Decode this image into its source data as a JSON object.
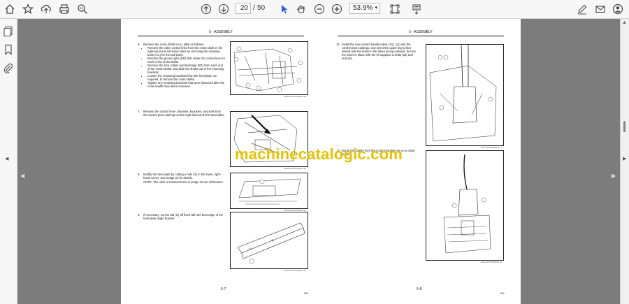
{
  "toolbar": {
    "page_current": "20",
    "page_sep": "/",
    "page_total": "50",
    "zoom": "53.9%"
  },
  "left_page": {
    "header": "5 - ASSEMBLY",
    "steps": [
      {
        "num": "6.",
        "intro": "Remove the cross shafts (AA), (BB) as follows:",
        "bullets": [
          "Remove the valve control links from the cross shaft on the right-hand and left-hand sides by removing the retaining bolts (CC) for the ball joints.",
          "Remove the groove pins (DD) that retain the control lever to each of the cross shafts.",
          "Remove the lock collars and bushings (EE) from each end of the cross shafts, and slide the shafts out of the mounting brackets.",
          "Loosen the mounting brackets from the heel plate, as required, to remove the cross shafts.",
          "Tighten any mounting brackets that were loosened after the cross shafts have been removed."
        ]
      },
      {
        "num": "7.",
        "intro": "Remove the control lever channels, knuckles, and links from the control pivot castings on the right-hand and left-hand sides.",
        "bullets": []
      },
      {
        "num": "8.",
        "intro": "Modify the heel plate by cutting a hole (X) in the lower, right-hand corner. See image 20 for details.",
        "note": "NOTE: The units of measurement in image 20 are millimeters.",
        "bullets": []
      },
      {
        "num": "9.",
        "intro": "If necessary, cut the tab (G) off flush with the bent edge of the heel plate angle bracket.",
        "bullets": []
      }
    ],
    "fig_ids": [
      "RAPH13XXXXBAAA 18",
      "RAPH13XXXXBAAA 19",
      "RAPH13XXXXBAAA 20",
      "RAPH13XXXXBAAA 21"
    ],
    "footer": "5-7",
    "footer_right": "EN"
  },
  "right_page": {
    "header": "5 - ASSEMBLY",
    "steps": [
      {
        "num": "12.",
        "intro": "Install the new control handle tubes (10), (11) into the control pivot castings, and orient the upper leg to face inward with the holes in the tubes facing outward. Secure the tubes in place with the kit supplied U-bolts (53) and nuts (6).",
        "bullets": []
      },
      {
        "num": "13.",
        "intro": "Route the cables from the control handles lay on a clean surface.",
        "bullets": []
      }
    ],
    "fig_ids": [
      "RAIL13XXXXBAAA 22",
      "RAIL13XXXXBAAA 23"
    ],
    "footer": "5-8",
    "footer_right": "EN"
  },
  "watermark": "machinecatalogic.com"
}
